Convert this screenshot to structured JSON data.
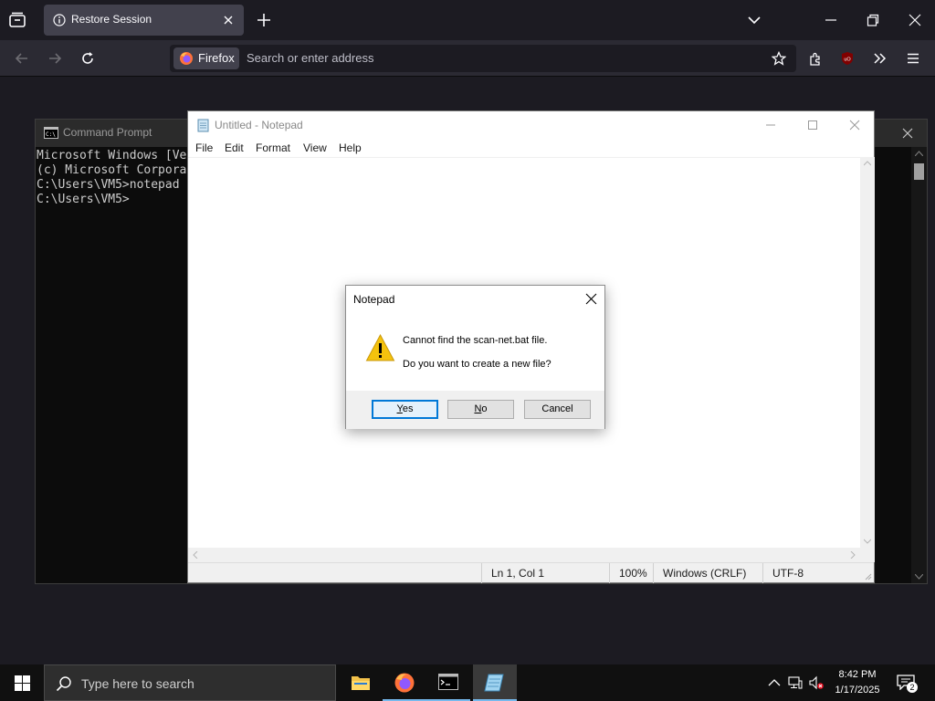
{
  "browser": {
    "tab": {
      "title": "Restore Session"
    },
    "identity_label": "Firefox",
    "url_placeholder": "Search or enter address"
  },
  "cmd": {
    "title": "Command Prompt",
    "lines": [
      "Microsoft Windows [Ve",
      "(c) Microsoft Corpora",
      "",
      "C:\\Users\\VM5>notepad",
      "",
      "C:\\Users\\VM5>"
    ]
  },
  "notepad": {
    "title": "Untitled - Notepad",
    "menu": [
      "File",
      "Edit",
      "Format",
      "View",
      "Help"
    ],
    "status": {
      "position": "Ln 1, Col 1",
      "zoom": "100%",
      "line_ending": "Windows (CRLF)",
      "encoding": "UTF-8"
    }
  },
  "dialog": {
    "title": "Notepad",
    "message1": "Cannot find the scan-net.bat file.",
    "message2": "Do you want to create a new file?",
    "buttons": {
      "yes_accel": "Y",
      "yes_rest": "es",
      "no_accel": "N",
      "no_rest": "o",
      "cancel": "Cancel"
    }
  },
  "taskbar": {
    "search_placeholder": "Type here to search",
    "time": "8:42 PM",
    "date": "1/17/2025",
    "notification_count": "2"
  },
  "colors": {
    "accent": "#0078d7",
    "warning": "#f4c20d",
    "firefox_bg": "#1c1b22",
    "taskbar_bg": "#101010"
  }
}
